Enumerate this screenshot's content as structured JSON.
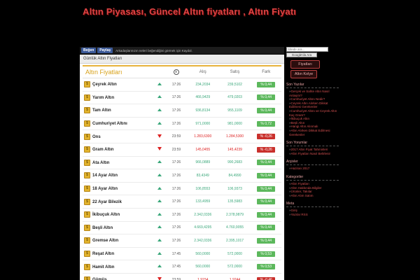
{
  "site": {
    "title": "Altın Piyasası, Güncel Altın fiyatları , Altın Fiyatı"
  },
  "share": {
    "fb_label": "Beğen",
    "share_label": "Paylaş",
    "text": "Arkadaşlarınızın neleri beğendiğini görmek için Kaydol."
  },
  "panel": {
    "heading": "Günlük Altın Fiyatları"
  },
  "table": {
    "title": "Altın Fiyatları",
    "headers": {
      "time_icon": "clock-icon",
      "buy": "Alış",
      "sell": "Satış",
      "change": "Fark"
    },
    "rows": [
      {
        "name": "Çeyrek Altın",
        "dir": "up",
        "time": "17:26",
        "buy": "234,2034",
        "sell": "239,5102",
        "change": "% 0,44"
      },
      {
        "name": "Yarım Altın",
        "dir": "up",
        "time": "17:26",
        "buy": "466,9429",
        "sell": "479,0203",
        "change": "% 0,44"
      },
      {
        "name": "Tam Altın",
        "dir": "up",
        "time": "17:26",
        "buy": "936,8134",
        "sell": "955,1109",
        "change": "% 0,44"
      },
      {
        "name": "Cumhuriyet Altını",
        "dir": "up",
        "time": "17:26",
        "buy": "971,0000",
        "sell": "981,0000",
        "change": "% 0,72"
      },
      {
        "name": "Ons",
        "dir": "down",
        "time": "23:59",
        "buy": "1.283,6300",
        "sell": "1.284,5300",
        "change": "% -0,26"
      },
      {
        "name": "Gram Altın",
        "dir": "down",
        "time": "23:59",
        "buy": "145,0455",
        "sell": "145,4239",
        "change": "% -0,26"
      },
      {
        "name": "Ata Altın",
        "dir": "up",
        "time": "17:26",
        "buy": "966,0889",
        "sell": "990,2683",
        "change": "% 0,44"
      },
      {
        "name": "14 Ayar Altın",
        "dir": "up",
        "time": "17:26",
        "buy": "83,4349",
        "sell": "84,4990",
        "change": "% 0,44"
      },
      {
        "name": "18 Ayar Altın",
        "dir": "up",
        "time": "17:26",
        "buy": "106,8553",
        "sell": "106,9373",
        "change": "% 0,44"
      },
      {
        "name": "22 Ayar Bilezik",
        "dir": "up",
        "time": "17:26",
        "buy": "133,4959",
        "sell": "135,5983",
        "change": "% 0,44"
      },
      {
        "name": "İkibuçuk Altın",
        "dir": "up",
        "time": "17:26",
        "buy": "2.342,0336",
        "sell": "2.378,9879",
        "change": "% 0,44"
      },
      {
        "name": "Beşli Altın",
        "dir": "up",
        "time": "17:26",
        "buy": "4.669,4295",
        "sell": "4.760,9055",
        "change": "% 0,44"
      },
      {
        "name": "Gremse Altın",
        "dir": "up",
        "time": "17:26",
        "buy": "2.342,0336",
        "sell": "2.395,1017",
        "change": "% 0,44"
      },
      {
        "name": "Reşat Altın",
        "dir": "up",
        "time": "17:45",
        "buy": "560,0000",
        "sell": "572,0000",
        "change": "% 0,53"
      },
      {
        "name": "Hamit Altın",
        "dir": "up",
        "time": "17:45",
        "buy": "560,0000",
        "sell": "572,0000",
        "change": "% 0,53"
      },
      {
        "name": "Gümüş",
        "dir": "down",
        "time": "23:59",
        "buy": "1,9154",
        "sell": "1,9244",
        "change": "% -0,46"
      }
    ]
  },
  "sidebar": {
    "search_placeholder": "Sitede ara...",
    "search_button": "Google'da Ara",
    "buttons": [
      "Fiyatları",
      "Altın Kolye"
    ],
    "sections": [
      {
        "title": "Son Yazılar",
        "links": [
          "Gerçek ve Sahte Altın Nasıl Anlaşılır?",
          "Cumhuriyet Altını Nedir?",
          "Ceyrek Altın Alırken Dikkat Edilmesi Gerekenler",
          "Cumhuriyet Altını ve Ceyrek Altın Kaç Gram?",
          "İkibuçuk Altın",
          "Beşli Altın",
          "Hangi Altın Alınmalı",
          "Altın Alırken Dikkat Edilmesi Gerekenler"
        ]
      },
      {
        "title": "Son Yorumlar",
        "links": [
          "2017 Altın Fiyat Tahminleri",
          "Altın Fiyatları Nasıl Belirlenir"
        ]
      },
      {
        "title": "Arşivler",
        "links": [
          "Haziran 2017"
        ]
      },
      {
        "title": "Kategoriler",
        "links": [
          "Altın Fiyatları",
          "Altın Hakkında Bilgiler",
          "Ürünler, Takılar",
          "Altın Alım Satım"
        ]
      },
      {
        "title": "Meta",
        "links": [
          "Giriş",
          "Yazılar RSS"
        ]
      }
    ]
  },
  "colors": {
    "accent": "#e8b33b",
    "up": "#3aa77a",
    "down": "#d22",
    "badge_up": "#5cb85c",
    "badge_down": "#c9302c"
  }
}
